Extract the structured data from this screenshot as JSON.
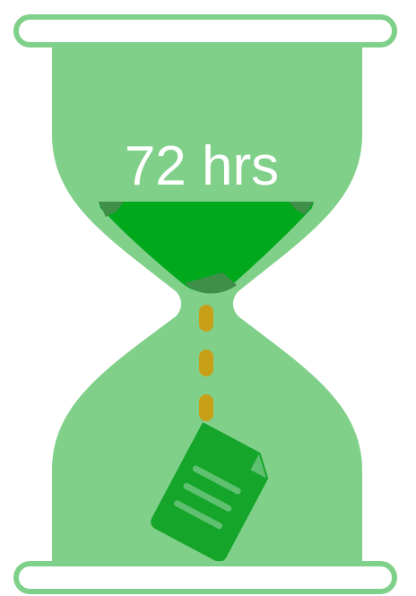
{
  "hourglass": {
    "label": "72 hrs",
    "icons": {
      "hourglass": "hourglass-icon",
      "document": "document-icon"
    },
    "colors": {
      "glass": "#80d08a",
      "glass_border": "#70c878",
      "sand": "#00a81c",
      "sand_shadow": "#3f8f48",
      "stream": "#c8a018",
      "document": "#15a52a",
      "document_lines": "#5fc070",
      "cap_fill": "#ffffff",
      "cap_stroke": "#7fd08a"
    }
  }
}
